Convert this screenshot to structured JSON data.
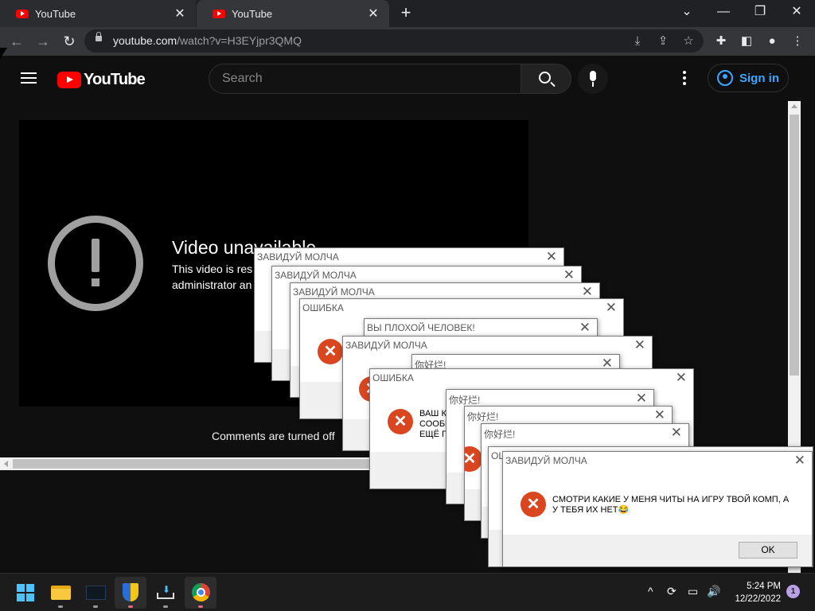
{
  "browser": {
    "tabs": [
      {
        "title": "YouTube",
        "close": "✕"
      },
      {
        "title": "YouTube",
        "close": "✕"
      }
    ],
    "new_tab": "+",
    "window_controls": {
      "dropdown": "⌄",
      "minimize": "—",
      "restore": "❐",
      "close": "✕"
    },
    "url_host": "youtube.com",
    "url_path": "/watch?v=H3EYjpr3QMQ"
  },
  "youtube": {
    "logo_text": "YouTube",
    "search_placeholder": "Search",
    "sign_in": "Sign in",
    "video_title": "Video unavailable",
    "video_msg_1": "This video is res",
    "video_msg_2": "administrator an",
    "comments": "Comments are turned off"
  },
  "dialogs": [
    {
      "title": "ЗАВИДУЙ МОЛЧА",
      "close": "✕"
    },
    {
      "title": "ЗАВИДУЙ МОЛЧА",
      "close": "✕"
    },
    {
      "title": "ЗАВИДУЙ МОЛЧА",
      "close": "✕"
    },
    {
      "title": "ОШИБКА",
      "close": "✕"
    },
    {
      "title": "ВЫ ПЛОХОЙ ЧЕЛОВЕК!",
      "close": "✕"
    },
    {
      "title": "ЗАВИДУЙ МОЛЧА",
      "close": "✕"
    },
    {
      "title": "你好烂!",
      "close": "✕"
    },
    {
      "title": "ОШИБКА",
      "close": "✕",
      "message": "ВАШ К\nСООБЩ\nЕЩЁ П"
    },
    {
      "title": "你好烂!",
      "close": "✕"
    },
    {
      "title": "你好烂!",
      "close": "✕"
    },
    {
      "title": "你好烂!",
      "close": "✕"
    },
    {
      "title": "ОШ",
      "close": "✕"
    },
    {
      "title": "ЗАВИДУЙ МОЛЧА",
      "close": "✕",
      "message": "СМОТРИ КАКИЕ У МЕНЯ ЧИТЫ НА ИГРУ ТВОЙ КОМП, А У ТЕБЯ ИХ НЕТ😂",
      "ok": "OK"
    }
  ],
  "taskbar": {
    "time": "5:24 PM",
    "date": "12/22/2022",
    "notifications": "1"
  },
  "colors": {
    "error_icon": "#d9461f",
    "accent_link": "#3ea6ff",
    "youtube_red": "#ff0000"
  }
}
